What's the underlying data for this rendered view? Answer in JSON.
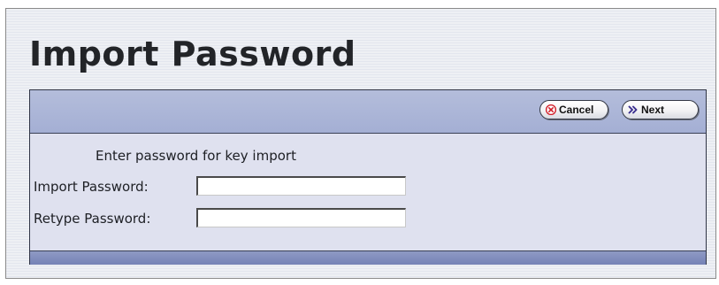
{
  "page": {
    "title": "Import Password"
  },
  "toolbar": {
    "cancel_label": "Cancel",
    "cancel_icon": "cancel-icon",
    "next_label": "Next",
    "next_icon": "double-chevron-right-icon"
  },
  "form": {
    "instruction": "Enter password for key import",
    "import_password": {
      "label": "Import Password:",
      "value": ""
    },
    "retype_password": {
      "label": "Retype Password:",
      "value": ""
    }
  },
  "colors": {
    "toolbar_bg": "#a4afd4",
    "panel_bg": "#dfe1ef",
    "footer_bar": "#7582b6",
    "cancel_icon": "#d2202a",
    "next_icon": "#3a2f8f"
  }
}
